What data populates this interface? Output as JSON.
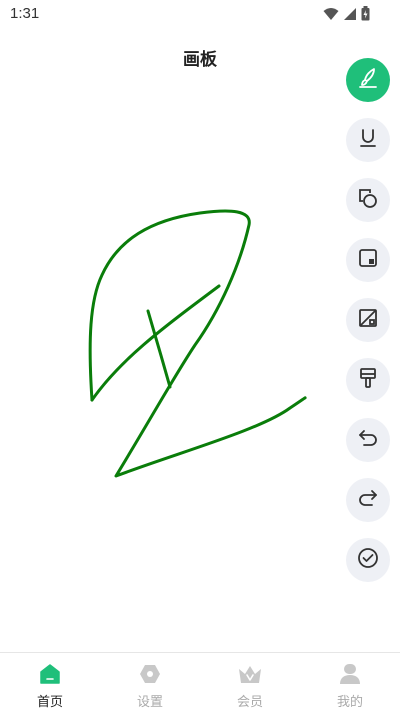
{
  "status_bar": {
    "time": "1:31",
    "icons": [
      "wifi-icon",
      "signal-icon",
      "battery-icon"
    ]
  },
  "header": {
    "title": "画板"
  },
  "colors": {
    "accent": "#1fbf7a",
    "stroke": "#0a7d0a",
    "tool_bg": "#eef0f5",
    "nav_inactive": "#c8c8c8"
  },
  "toolbar": {
    "tools": [
      {
        "name": "brush-tool",
        "icon": "brush-icon",
        "active": true
      },
      {
        "name": "underline-tool",
        "icon": "underline-icon",
        "active": false
      },
      {
        "name": "shape-tool",
        "icon": "shapes-icon",
        "active": false
      },
      {
        "name": "fill-square-tool",
        "icon": "square-corner-icon",
        "active": false
      },
      {
        "name": "slash-square-tool",
        "icon": "square-slash-icon",
        "active": false
      },
      {
        "name": "paint-roller-tool",
        "icon": "paint-roller-icon",
        "active": false
      },
      {
        "name": "undo-tool",
        "icon": "undo-icon",
        "active": false
      },
      {
        "name": "redo-tool",
        "icon": "redo-icon",
        "active": false
      },
      {
        "name": "confirm-tool",
        "icon": "check-circle-icon",
        "active": false
      }
    ]
  },
  "bottom_nav": {
    "items": [
      {
        "label": "首页",
        "icon": "home-icon",
        "active": true
      },
      {
        "label": "设置",
        "icon": "settings-icon",
        "active": false
      },
      {
        "label": "会员",
        "icon": "crown-icon",
        "active": false
      },
      {
        "label": "我的",
        "icon": "user-icon",
        "active": false
      }
    ]
  }
}
